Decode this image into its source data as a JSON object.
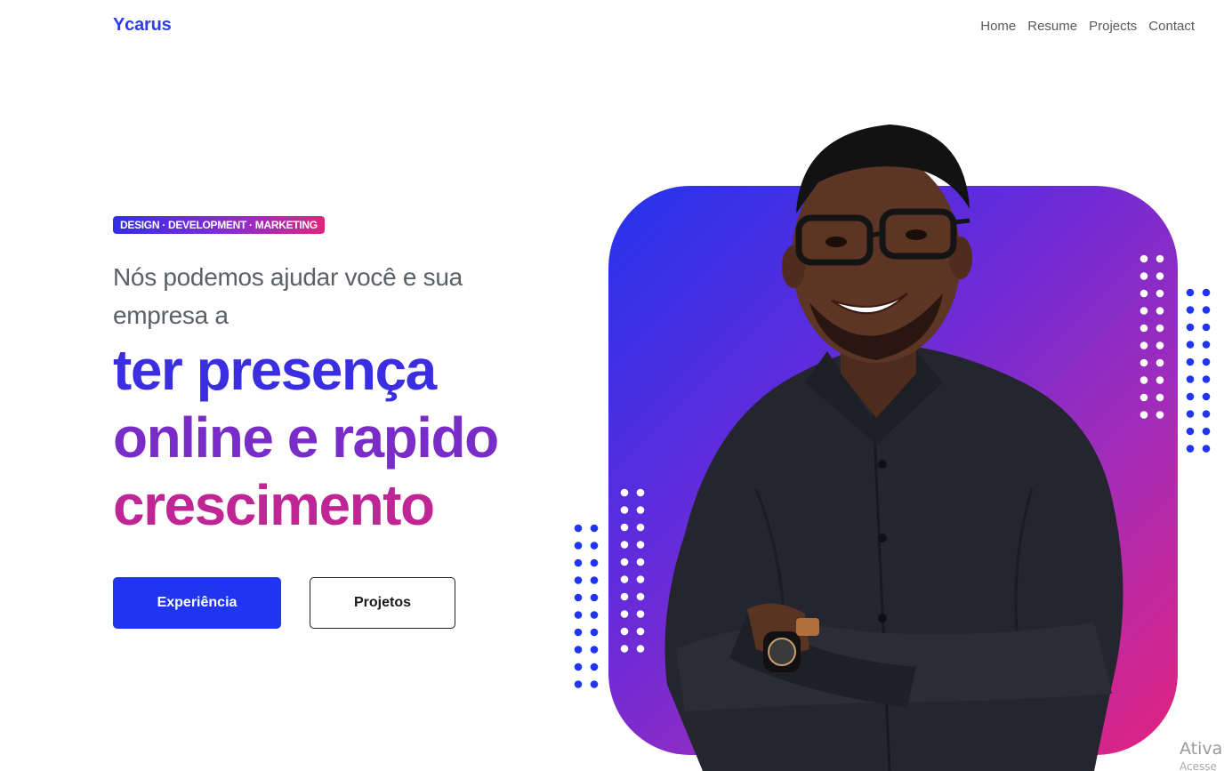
{
  "header": {
    "logo": "Ycarus",
    "nav": [
      "Home",
      "Resume",
      "Projects",
      "Contact"
    ]
  },
  "hero": {
    "tag": "DESIGN · DEVELOPMENT · MARKETING",
    "subtitle": "Nós podemos ajudar você e sua empresa a",
    "headline": [
      "ter presença",
      "online e rapido",
      "crescimento"
    ],
    "buttons": {
      "primary": "Experiência",
      "secondary": "Projetos"
    }
  },
  "watermark": {
    "title": "Ativar",
    "subtitle": "Acesse"
  },
  "colors": {
    "brand": "#2f3de6",
    "button_primary": "#1f35f0",
    "gradient_start": "#2433ec",
    "gradient_end": "#e3237e",
    "dot_blue": "#1f35f0",
    "dot_white": "#ffffff"
  },
  "icons": [
    "dot-grid-decoration"
  ]
}
